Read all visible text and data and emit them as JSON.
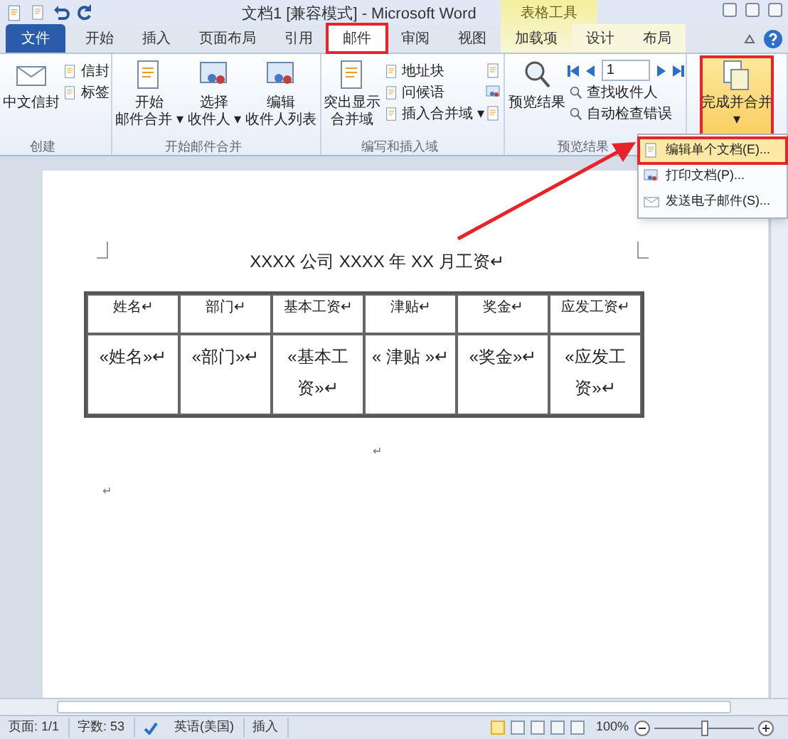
{
  "window": {
    "title": "文档1 [兼容模式] - Microsoft Word",
    "context_tab_header": "表格工具"
  },
  "tabs": [
    {
      "label": "文件",
      "kind": "file",
      "selected": false,
      "highlighted": false
    },
    {
      "label": "开始",
      "kind": "normal",
      "selected": false,
      "highlighted": false
    },
    {
      "label": "插入",
      "kind": "normal",
      "selected": false,
      "highlighted": false
    },
    {
      "label": "页面布局",
      "kind": "normal",
      "selected": false,
      "highlighted": false
    },
    {
      "label": "引用",
      "kind": "normal",
      "selected": false,
      "highlighted": false
    },
    {
      "label": "邮件",
      "kind": "normal",
      "selected": true,
      "highlighted": true
    },
    {
      "label": "审阅",
      "kind": "normal",
      "selected": false,
      "highlighted": false
    },
    {
      "label": "视图",
      "kind": "normal",
      "selected": false,
      "highlighted": false
    },
    {
      "label": "加载项",
      "kind": "normal",
      "selected": false,
      "highlighted": false
    },
    {
      "label": "设计",
      "kind": "contextual",
      "selected": false,
      "highlighted": false
    },
    {
      "label": "布局",
      "kind": "contextual",
      "selected": false,
      "highlighted": false
    }
  ],
  "ribbon": [
    {
      "label": "创建",
      "items": [
        {
          "kind": "large",
          "lines": [
            "中文信封"
          ],
          "highlighted": false
        },
        {
          "kind": "smalls",
          "labels": [
            "信封",
            "标签"
          ]
        }
      ]
    },
    {
      "label": "开始邮件合并",
      "items": [
        {
          "kind": "large",
          "lines": [
            "开始",
            "邮件合并 ▾"
          ],
          "highlighted": false
        },
        {
          "kind": "large",
          "lines": [
            "选择",
            "收件人 ▾"
          ],
          "highlighted": false
        },
        {
          "kind": "large",
          "lines": [
            "编辑",
            "收件人列表"
          ],
          "highlighted": false
        }
      ]
    },
    {
      "label": "编写和插入域",
      "items": [
        {
          "kind": "large",
          "lines": [
            "突出显示",
            "合并域"
          ],
          "highlighted": false
        },
        {
          "kind": "smalls",
          "labels": [
            "地址块",
            "问候语",
            "插入合并域 ▾"
          ]
        },
        {
          "kind": "icons"
        }
      ]
    },
    {
      "label": "预览结果",
      "items": [
        {
          "kind": "large",
          "lines": [
            "预览结果"
          ],
          "highlighted": false
        },
        {
          "kind": "nav",
          "value": "1",
          "labels": [
            "查找收件人",
            "自动检查错误"
          ]
        }
      ]
    },
    {
      "items": [
        {
          "kind": "large",
          "lines": [
            "完成并合并",
            "▾"
          ],
          "highlighted": true
        }
      ]
    }
  ],
  "menu": [
    {
      "label": "编辑单个文档(E)...",
      "selected": true,
      "highlighted": true
    },
    {
      "label": "打印文档(P)...",
      "selected": false,
      "highlighted": false
    },
    {
      "label": "发送电子邮件(S)...",
      "selected": false,
      "highlighted": false
    }
  ],
  "document": {
    "title": "XXXX 公司 XXXX 年 XX 月工资↵",
    "table": {
      "header": [
        "姓名↵",
        "部门↵",
        "基本工资↵",
        "津贴↵",
        "奖金↵",
        "应发工资↵"
      ],
      "row": [
        "«姓名»↵",
        "«部门»↵",
        "«基本工资»↵",
        "« 津贴 »↵",
        "«奖金»↵",
        "«应发工资»↵"
      ]
    },
    "after_marks": [
      "↵",
      "↵"
    ]
  },
  "status_bar": {
    "items": [
      "页面: 1/1",
      "字数: 53",
      "英语(美国)",
      "插入"
    ],
    "zoom": "100%",
    "zoom_level": {
      "level": 0.5
    }
  }
}
